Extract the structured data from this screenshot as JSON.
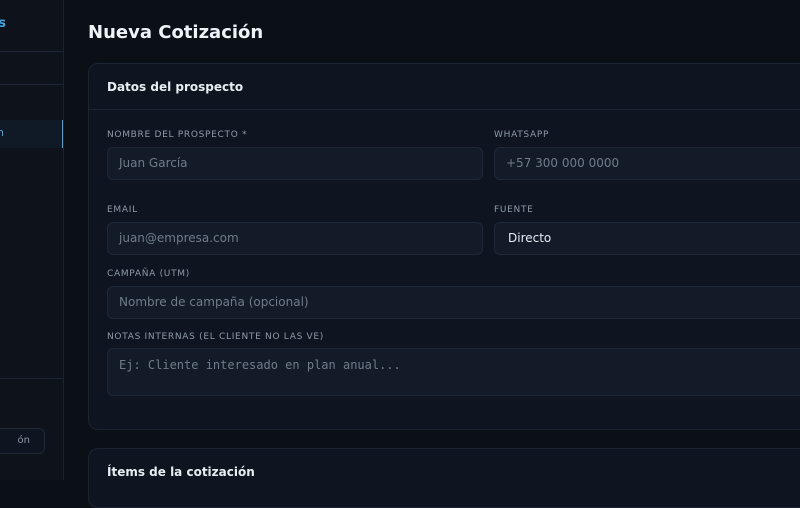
{
  "sidebar": {
    "brand_text": "s",
    "active_item_label": "n",
    "bottom_button_label": "ón"
  },
  "page": {
    "title": "Nueva Cotización"
  },
  "prospect_card": {
    "title": "Datos del prospecto",
    "name": {
      "label": "NOMBRE DEL PROSPECTO *",
      "placeholder": "Juan García"
    },
    "whatsapp": {
      "label": "WHATSAPP",
      "placeholder": "+57 300 000 0000"
    },
    "email": {
      "label": "EMAIL",
      "placeholder": "juan@empresa.com"
    },
    "source": {
      "label": "FUENTE",
      "value": "Directo"
    },
    "campaign": {
      "label": "CAMPAÑA (UTM)",
      "placeholder": "Nombre de campaña (opcional)"
    },
    "notes": {
      "label": "NOTAS INTERNAS (EL CLIENTE NO LAS VE)",
      "placeholder": "Ej: Cliente interesado en plan anual..."
    }
  },
  "items_card": {
    "title": "Ítems de la cotización"
  }
}
